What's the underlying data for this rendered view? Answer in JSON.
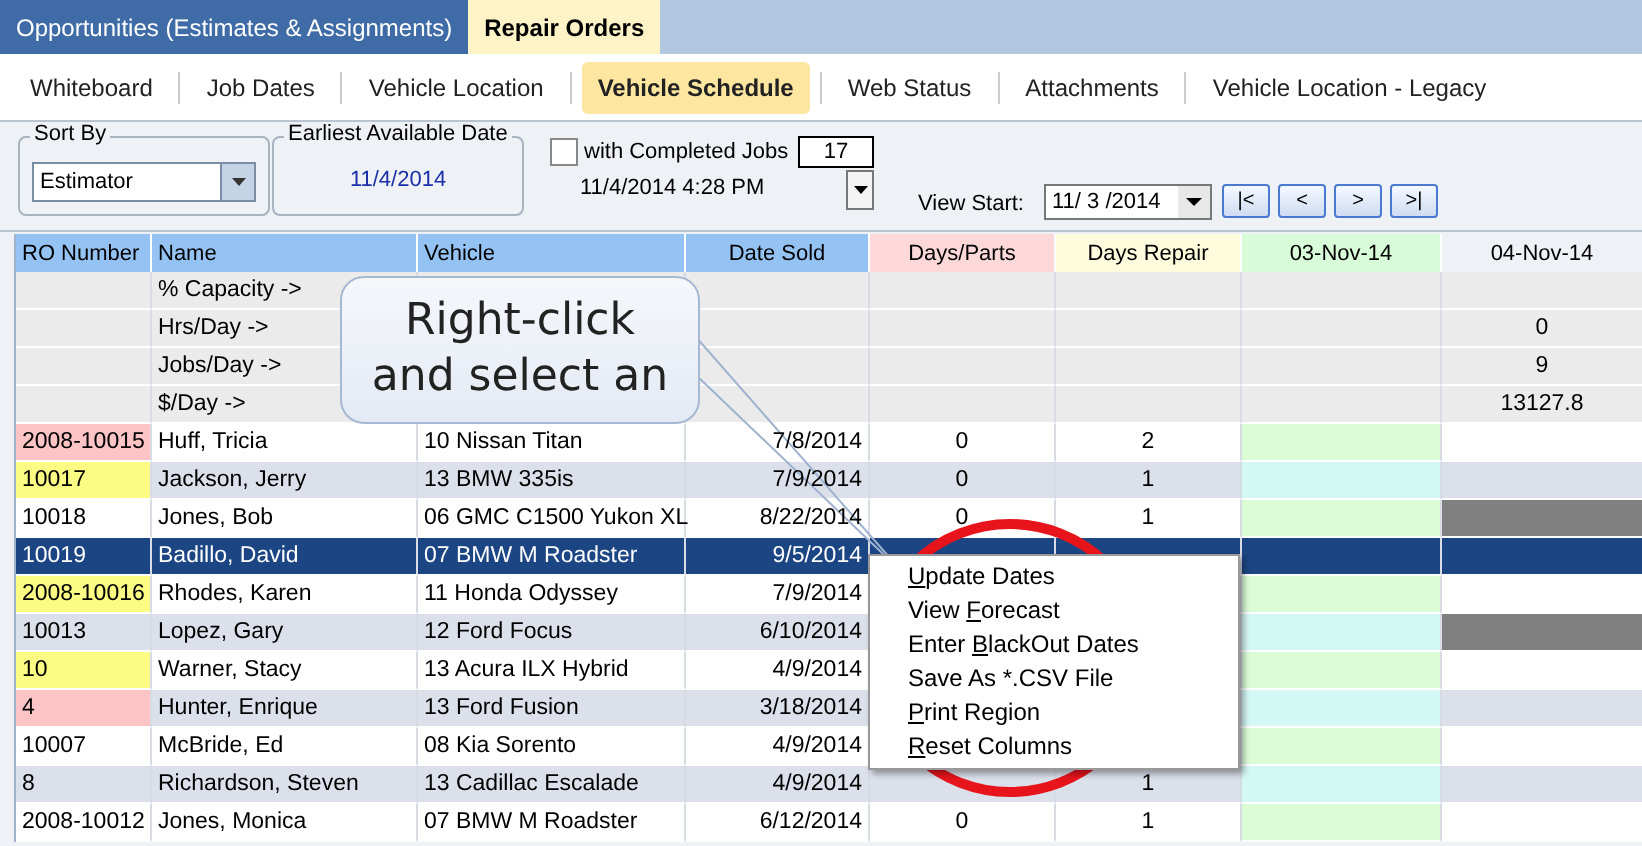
{
  "top_tabs": [
    {
      "label": "Opportunities (Estimates & Assignments)",
      "selected": false
    },
    {
      "label": "Repair Orders",
      "selected": true
    }
  ],
  "sub_tabs": [
    {
      "label": "Whiteboard",
      "selected": false
    },
    {
      "label": "Job Dates",
      "selected": false
    },
    {
      "label": "Vehicle Location",
      "selected": false
    },
    {
      "label": "Vehicle Schedule",
      "selected": true
    },
    {
      "label": "Web Status",
      "selected": false
    },
    {
      "label": "Attachments",
      "selected": false
    },
    {
      "label": "Vehicle Location - Legacy",
      "selected": false
    }
  ],
  "toolbar": {
    "sort_by": {
      "legend": "Sort By",
      "value": "Estimator"
    },
    "earliest": {
      "legend": "Earliest Available Date",
      "value": "11/4/2014"
    },
    "completed_jobs": {
      "label": "with Completed Jobs",
      "checked": false
    },
    "count": "17",
    "timestamp": "11/4/2014 4:28 PM",
    "view_start": {
      "label": "View Start:",
      "value": "11/ 3 /2014"
    },
    "nav_buttons": [
      "|<",
      "<",
      ">",
      ">|"
    ]
  },
  "columns": [
    {
      "label": "RO Number",
      "color": "#94c2f2"
    },
    {
      "label": "Name",
      "color": "#94c2f2"
    },
    {
      "label": "Vehicle",
      "color": "#94c2f2"
    },
    {
      "label": "Date Sold",
      "color": "#94c2f2"
    },
    {
      "label": "Days/Parts",
      "color": "#fcd8d8"
    },
    {
      "label": "Days Repair",
      "color": "#fefcdc"
    },
    {
      "label": "03-Nov-14",
      "color": "#d8fcd8"
    },
    {
      "label": "04-Nov-14",
      "color": "#eef1f6"
    }
  ],
  "summary_rows": [
    {
      "label": "% Capacity ->"
    },
    {
      "label": "Hrs/Day ->",
      "day_2": "0"
    },
    {
      "label": "Jobs/Day ->",
      "day_2": "9"
    },
    {
      "label": "$/Day ->",
      "day_2": "13127.8"
    }
  ],
  "rows": [
    {
      "ro": "2008-10015",
      "color": "#fcc4c4",
      "name": "Huff, Tricia",
      "vehicle": "10 Nissan Titan",
      "date_sold": "7/8/2014",
      "days_parts": "0",
      "days_repair": "2",
      "selected": false,
      "day_1": {
        "color": "#dcfcd8"
      }
    },
    {
      "ro": "10017",
      "color": "#fcfc84",
      "name": "Jackson, Jerry",
      "vehicle": "13 BMW 335is",
      "date_sold": "7/9/2014",
      "days_parts": "0",
      "days_repair": "1",
      "selected": false,
      "day_1": {
        "color": "#d4f8f4"
      }
    },
    {
      "ro": "10018",
      "name": "Jones, Bob",
      "vehicle": "06 GMC C1500 Yukon XL",
      "date_sold": "8/22/2014",
      "days_parts": "0",
      "days_repair": "1",
      "selected": false,
      "day_1": {
        "color": "#dcfcd8"
      },
      "day_2": {
        "color": "#808080"
      }
    },
    {
      "ro": "10019",
      "name": "Badillo, David",
      "vehicle": "07 BMW M Roadster",
      "date_sold": "9/5/2014",
      "selected": true
    },
    {
      "ro": "2008-10016",
      "color": "#fcfc84",
      "name": "Rhodes, Karen",
      "vehicle": "11 Honda Odyssey",
      "date_sold": "7/9/2014",
      "selected": false,
      "day_1": {
        "color": "#dcfcd8"
      }
    },
    {
      "ro": "10013",
      "name": "Lopez, Gary",
      "vehicle": "12 Ford Focus",
      "date_sold": "6/10/2014",
      "selected": false,
      "day_1": {
        "color": "#d4f8f4"
      },
      "day_2": {
        "color": "#808080"
      }
    },
    {
      "ro": "10",
      "color": "#fcfc84",
      "name": "Warner, Stacy",
      "vehicle": "13 Acura ILX Hybrid",
      "date_sold": "4/9/2014",
      "selected": false,
      "day_1": {
        "color": "#dcfcd8"
      }
    },
    {
      "ro": "4",
      "color": "#fcc4c4",
      "name": "Hunter, Enrique",
      "vehicle": "13 Ford Fusion",
      "date_sold": "3/18/2014",
      "selected": false,
      "day_1": {
        "color": "#d4f8f4"
      }
    },
    {
      "ro": "10007",
      "name": "McBride, Ed",
      "vehicle": "08 Kia Sorento",
      "date_sold": "4/9/2014",
      "selected": false,
      "day_1": {
        "color": "#dcfcd8"
      }
    },
    {
      "ro": "8",
      "name": "Richardson, Steven",
      "vehicle": "13 Cadillac Escalade",
      "date_sold": "4/9/2014",
      "days_repair": "1",
      "selected": false,
      "day_1": {
        "color": "#d4f8f4"
      }
    },
    {
      "ro": "2008-10012",
      "name": "Jones, Monica",
      "vehicle": "07 BMW M Roadster",
      "date_sold": "6/12/2014",
      "days_parts": "0",
      "days_repair": "1",
      "selected": false,
      "day_1": {
        "color": "#dcfcd8"
      }
    }
  ],
  "callout": {
    "lines": [
      "Right-click",
      "and select an"
    ]
  },
  "context_menu": [
    {
      "key": "U",
      "rest": "pdate Dates"
    },
    {
      "lead": "View ",
      "key": "F",
      "rest": "orecast"
    },
    {
      "lead": "Enter ",
      "key": "B",
      "rest": "lackOut Dates"
    },
    {
      "rest": "Save As *.CSV File"
    },
    {
      "key": "P",
      "rest": "rint Region"
    },
    {
      "key": "R",
      "rest": "eset Columns"
    }
  ]
}
